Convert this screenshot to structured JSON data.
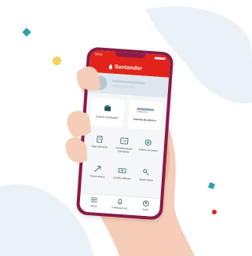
{
  "colors": {
    "brand_red": "#e2231a",
    "blob_blue": "#e9f1f6",
    "phone_frame": "#8b1a47",
    "hand": "#f6cdb8",
    "sleeve_teal": "#2aa2a8",
    "confetti_yellow": "#f5d25a",
    "confetti_red": "#e2231a"
  },
  "status_bar": {
    "time": "09:41"
  },
  "header": {
    "brand": "Santander",
    "logo_icon": "flame-icon"
  },
  "profile": {
    "avatar_icon": "avatar-placeholder"
  },
  "cards": [
    {
      "label": "Cuenta Santander",
      "icon": "wallet-icon"
    },
    {
      "label": "Cuenta de ahorro",
      "icon": "card-icon"
    }
  ],
  "shortcuts": [
    {
      "label": "Pago servicios",
      "icon": "receipt-icon"
    },
    {
      "label": "Transferencias bancarias",
      "icon": "transfer-icon"
    },
    {
      "label": "Cobros en pesos",
      "icon": "coins-icon"
    },
    {
      "label": "Enviar dinero",
      "icon": "send-icon"
    },
    {
      "label": "Cambio dólares",
      "icon": "exchange-icon"
    },
    {
      "label": "Súper Clave",
      "icon": "key-icon"
    }
  ],
  "bottom_nav": [
    {
      "label": "Menú",
      "icon": "menu-icon"
    },
    {
      "label": "Notificaciones",
      "icon": "bell-icon"
    },
    {
      "label": "Perfil",
      "icon": "user-icon"
    }
  ]
}
